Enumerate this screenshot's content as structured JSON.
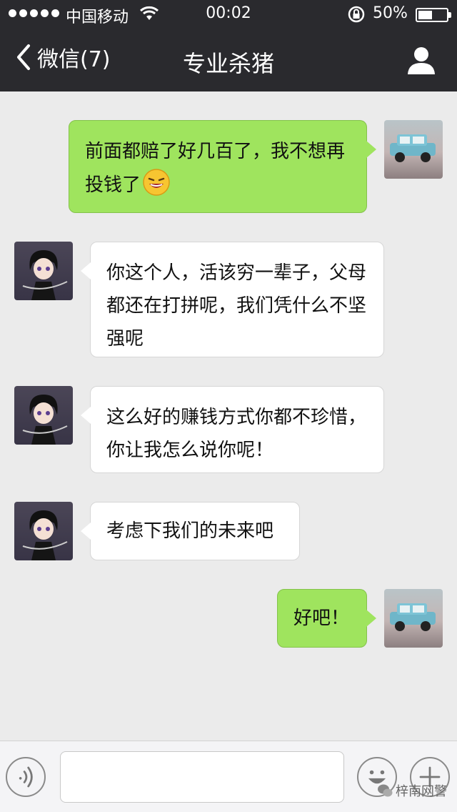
{
  "status": {
    "carrier": "中国移动",
    "time": "00:02",
    "battery": "50%",
    "battery_level": 0.5
  },
  "nav": {
    "back_label": "微信(7)",
    "title": "专业杀猪"
  },
  "messages": [
    {
      "from": "me",
      "text": "前面都赔了好几百了，我不想再投钱了",
      "emoji": "laughing-crying-emoji"
    },
    {
      "from": "other",
      "text": "你这个人，活该穷一辈子，父母都还在打拼呢，我们凭什么不坚强呢"
    },
    {
      "from": "other",
      "text": "这么好的赚钱方式你都不珍惜，你让我怎么说你呢！"
    },
    {
      "from": "other",
      "text": "考虑下我们的未来吧"
    },
    {
      "from": "me",
      "text": "好吧！"
    }
  ],
  "input": {
    "value": "",
    "placeholder": ""
  },
  "watermark": "梓南网警",
  "colors": {
    "nav_bg": "#2a2a2e",
    "chat_bg": "#ebebeb",
    "my_bubble": "#9fe45e",
    "other_bubble": "#ffffff"
  },
  "icons": [
    "signal-dots-icon",
    "wifi-icon",
    "rotation-lock-icon",
    "battery-icon",
    "back-chevron-icon",
    "profile-icon",
    "voice-icon",
    "emoji-face-icon",
    "plus-icon",
    "wechat-logo-icon"
  ]
}
